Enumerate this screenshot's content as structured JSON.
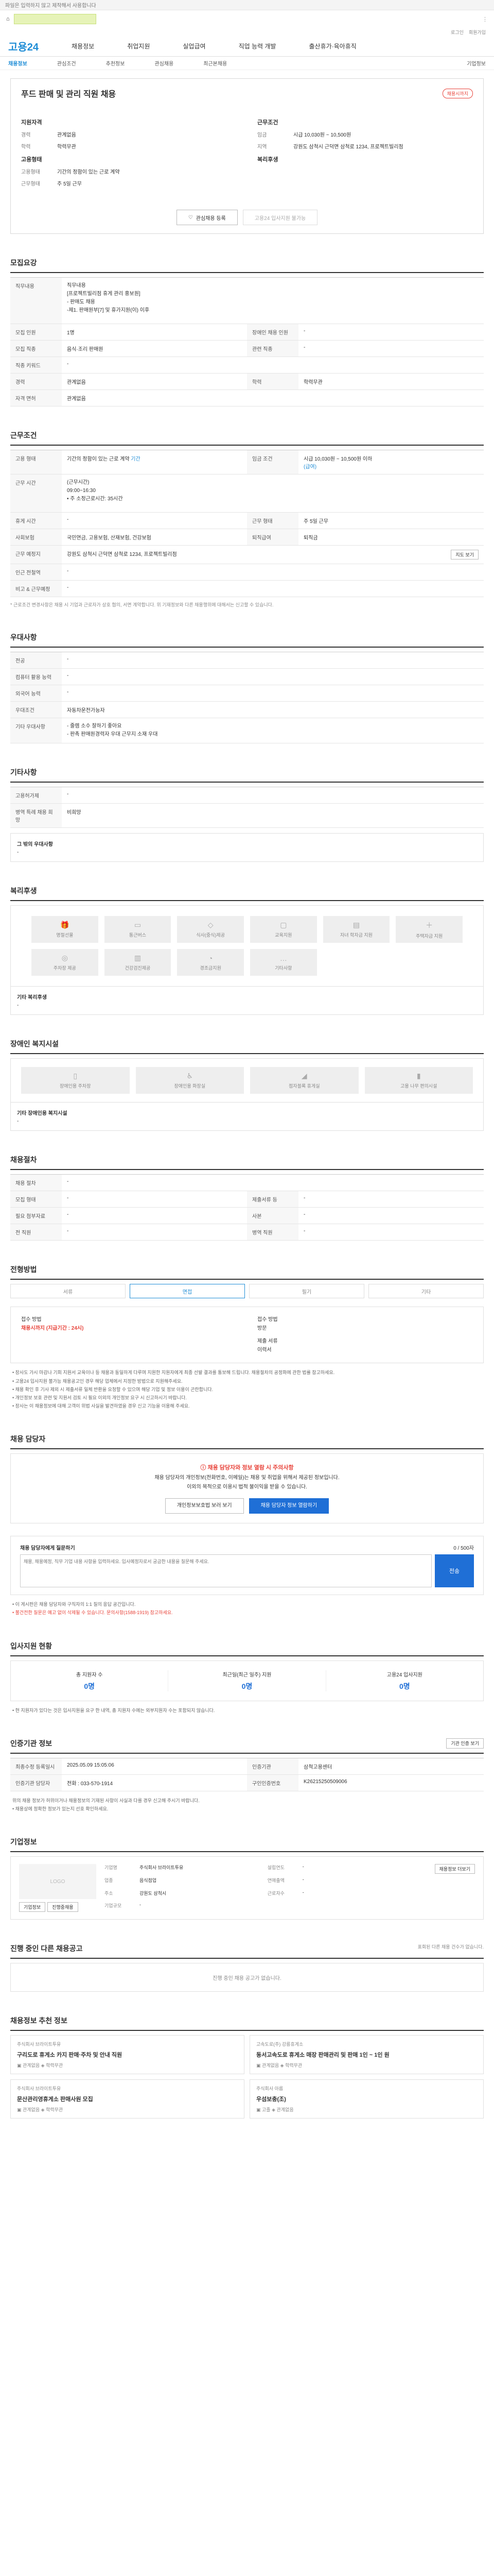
{
  "notice": "파일은 입력하지 않고 제작해서 사용합니다",
  "util": [
    "로그인",
    "회원가입"
  ],
  "logo": "고용24",
  "gnb": [
    "채용정보",
    "취업지원",
    "실업급여",
    "직업 능력 개발",
    "출산휴가·육아휴직"
  ],
  "lnb": [
    "채용정보",
    "관심조건",
    "추천정보",
    "관심채용",
    "최근본채용",
    "기업정보"
  ],
  "job": {
    "title": "푸드 판매 및 관리 직원 채용",
    "badge": "채용시까지",
    "left_head": "지원자격",
    "right_head": "근무조건",
    "left": [
      {
        "k": "경력",
        "v": "관계없음"
      },
      {
        "k": "학력",
        "v": "학력무관"
      }
    ],
    "left_head2": "고용형태",
    "left2": [
      {
        "k": "고용형태",
        "v": "기간의 정함이 있는 근로 계약"
      },
      {
        "k": "근무형태",
        "v": "주 5일 근무"
      }
    ],
    "right": [
      {
        "k": "임금",
        "v": "시급 10,030원 ~ 10,500원"
      },
      {
        "k": "지역",
        "v": "강원도 삼척시 근덕면 삼척로 1234, 프로젝트빌리점"
      }
    ],
    "right_head2": "복리후생",
    "btn_save": "관심채용 등록",
    "btn_apply": "고용24 입사지원 불가능"
  },
  "recruit": {
    "title": "모집요강",
    "duty_label": "직무내용",
    "duty": "직무내용\n[프로젝트빌리점 휴게 관리 홍보원]\n- 판매도 채용\n-제1. 판매원부[7] 및 휴가지원(이) 이후",
    "rows": [
      {
        "k": "모집 인원",
        "v": "1명",
        "k2": "장애인 채용 인원",
        "v2": "-"
      },
      {
        "k": "모집 직종",
        "v": "음식·조리 판매원",
        "k2": "관련 직종",
        "v2": "-"
      },
      {
        "k": "직종 키워드",
        "v": "-",
        "k2": "",
        "v2": ""
      },
      {
        "k": "경력",
        "v": "관계없음",
        "k2": "학력",
        "v2": "학력무관"
      },
      {
        "k": "자격 면허",
        "v": "관계없음",
        "k2": "",
        "v2": ""
      }
    ]
  },
  "condition": {
    "title": "근무조건",
    "employ_type": "기간의 정함이 있는 근로 계약",
    "employ_type_link": "기간",
    "wage_label": "임금 조건",
    "wage": "시급 10,030원 ~ 10,500원 이하",
    "wage_link": "(급여)",
    "hours_label": "근무 시간",
    "hours": "(근무시간)\n09:00~16:30\n• 주 소정근로시간: 35시간",
    "work_type_label": "근무 형태",
    "work_type": "주 5일 근무",
    "etc_rows": [
      {
        "k": "휴게 시간",
        "v": "-",
        "k2": "근무 형태",
        "v2": "주 5일 근무"
      },
      {
        "k": "사회보험",
        "v": "국민연금, 고용보험, 산재보험, 건강보험",
        "k2": "퇴직급여",
        "v2": "퇴직금"
      },
      {
        "k": "근무 예정지",
        "v": "강원도 삼척시 근덕면 삼척로 1234, 프로젝트빌리점",
        "k2": "",
        "v2": ""
      },
      {
        "k": "인근 전철역",
        "v": "-",
        "k2": "",
        "v2": ""
      },
      {
        "k": "비고 & 근무예정",
        "v": "-",
        "k2": "",
        "v2": ""
      }
    ],
    "map_btn": "지도 보기",
    "note": "* 근로조건 변경사항은 채용 시 기업과 근로자가 상호 협의, 서면 계약합니다. 위 기재정보와 다른 채용행위에 대해서는 신고할 수 있습니다."
  },
  "prefer": {
    "title": "우대사항",
    "rows": [
      {
        "k": "전공",
        "v": "-"
      },
      {
        "k": "컴퓨터 활용 능력",
        "v": "-"
      },
      {
        "k": "외국어 능력",
        "v": "-"
      },
      {
        "k": "우대조건",
        "v": "자동차운전가능자"
      },
      {
        "k": "기타 우대사항",
        "v": "- 줄렘 소수 잘하기 좋아요\n- 판촉 판매원경력자 우대 근무지 소재 우대"
      }
    ]
  },
  "other": {
    "title": "기타사항",
    "rows": [
      {
        "k": "고용허가제",
        "v": "-"
      },
      {
        "k": "병역 특례 채용 희망",
        "v": "비희망"
      }
    ],
    "etc_label": "그 밖의 우대사항",
    "etc": "-"
  },
  "welfare": {
    "title": "복리후생",
    "items": [
      {
        "icon": "gift-icon",
        "glyph": "🎁",
        "label": "명절선물"
      },
      {
        "icon": "bus-icon",
        "glyph": "▭",
        "label": "통근버스"
      },
      {
        "icon": "meal-icon",
        "glyph": "◇",
        "label": "식사(중식)제공"
      },
      {
        "icon": "gift-box-icon",
        "glyph": "▢",
        "label": "교육지원"
      },
      {
        "icon": "doc-icon",
        "glyph": "▤",
        "label": "자녀 학자금 지원"
      },
      {
        "icon": "plus-icon",
        "glyph": "＋",
        "label": "주택자금 지원"
      },
      {
        "icon": "car-icon",
        "glyph": "◎",
        "label": "주차장 제공"
      },
      {
        "icon": "leave-icon",
        "glyph": "▥",
        "label": "건강검진제공"
      },
      {
        "icon": "clock-icon",
        "glyph": "◔",
        "label": "경조금지원"
      },
      {
        "icon": "dots-icon",
        "glyph": "…",
        "label": "기타사항"
      }
    ],
    "etc_label": "기타 복리후생",
    "etc": "-"
  },
  "disabled": {
    "title": "장애인 복지시설",
    "items": [
      {
        "icon": "elevator-icon",
        "glyph": "▯",
        "label": "장애인용 주차장"
      },
      {
        "icon": "toilet-icon",
        "glyph": "♿",
        "label": "장애인용 화장실"
      },
      {
        "icon": "ramp-icon",
        "glyph": "◢",
        "label": "점자블록 휴게실"
      },
      {
        "icon": "door-icon",
        "glyph": "▮",
        "label": "고용 나무 편의시설"
      }
    ],
    "etc_label": "기타 장애인용 복지시설",
    "etc": "-"
  },
  "transfer": {
    "title": "채용절차",
    "rows": [
      {
        "k": "채용 절차",
        "v": "-",
        "k2": "",
        "v2": ""
      },
      {
        "k": "모집 형태",
        "v": "-",
        "k2": "제출서류 등",
        "v2": "-"
      },
      {
        "k": "필요 첨부자료",
        "v": "-",
        "k2": "사본",
        "v2": "-"
      },
      {
        "k": "전 직원",
        "v": "-",
        "k2": "병역 직원",
        "v2": "-"
      }
    ]
  },
  "progress": {
    "title": "전형방법",
    "steps": [
      "서류",
      "면접",
      "필기",
      "기타"
    ],
    "method_head": "접수 방법",
    "method_val": "채용시까지 (지급기간 : 24시)",
    "method_head2": "접수 방법",
    "method_val2": "방문",
    "method_head3": "제출 서류",
    "method_val3": "이력서",
    "bullets": [
      "• 장사도 가시 마감나 기회 지원서 교육이나 등 채용과 동일하게 다루며 지원한 지원자에게 최종 선발 결과를 통보해 드립니다. 채용절차의 공정화에 관한 법률 참고하세요.",
      "• 고용24 입사지원 불가능 채용공고인 경우 해당 업체에서 지정한 방법으로 지원해주세요.",
      "• 채용 확인 후 기사 제외 시 제출서류 일체 반환을 요청할 수 있으며 해당 기업 및 정보 이용이 곤란합니다.",
      "• 개인정보 보호 관련 및 지원서 검토 시 필요 이외의 개인정보 요구 시 신고하시기 바랍니다.",
      "• 장사는 이 채용정보에 대해 고객이 위법 사실을 발견하였을 경우 신고 기능을 이용해 주세요."
    ]
  },
  "manager": {
    "title": "채용 담당자",
    "alert_title": "채용 담당자와 정보 열람 시 주의사항",
    "alert_body": "채용 담당자의 개인정보(전화번호, 이메일)는 채용 및 취업을 위해서 제공된 정보입니다.\n이외의 목적으로 이용시 법적 불이익을 받을 수 있습니다.",
    "btn_view": "개인정보보호법 보러 보기",
    "btn_open": "채용 담당자 정보 열람하기"
  },
  "qa": {
    "title": "채용 담당자에게 질문하기",
    "counter": "0 / 500자",
    "placeholder": "채용, 채용예정, 직무 기업 내용 사항을 입력하세요. 입사예정자로서 궁금한 내용을 질문해 주세요.",
    "submit": "전송",
    "notes": [
      "• 이 게시판은 채용 담당자와 구직자의 1:1 질의 응답 공간입니다.",
      "• 불건전한 질문은 예고 없이 삭제될 수 있습니다. 문의사항(1588-1919) 참고하세요."
    ]
  },
  "stats": {
    "title": "입사지원 현황",
    "items": [
      {
        "label": "총 지원자 수",
        "value": "0명"
      },
      {
        "label": "최근일(최근 일주) 지원",
        "value": "0명"
      },
      {
        "label": "고용24 입사지원",
        "value": "0명"
      }
    ],
    "note": "• 현 지원자가 있다는 것은 입사지원을 요구 한 내역, 총 지원자 수에는 외부지원자 수는 포함되지 않습니다."
  },
  "cert": {
    "title": "인증기관 정보",
    "btn": "기관 인증 보기",
    "rows": [
      {
        "k": "최종수정 등록일시",
        "v": "2025.05.09 15:05:06",
        "k2": "인증기관",
        "v2": "삼척고용센터"
      },
      {
        "k": "인증기관 담당자",
        "v": "전화 : 033-570-1914",
        "k2": "구인인증번호",
        "v2": "K26215250509006"
      }
    ],
    "notes": [
      "위의 채용 정보가 허위이거나 채용정보의 기재된 사항이 사실과 다를 경우 신고해 주시기 바랍니다.",
      "• 채용상에 정확한 정보가 있는지 선호 확인하세요."
    ]
  },
  "company": {
    "title": "기업정보",
    "logo": "LOGO",
    "btn_info": "기업정보",
    "btn_jobs": "진행중채용",
    "rows": [
      {
        "k": "기업명",
        "v": "주식회사 브라이트투유",
        "k2": "설립연도",
        "v2": "-"
      },
      {
        "k": "업종",
        "v": "음식점업",
        "k2": "연매출액",
        "v2": "-"
      },
      {
        "k": "주소",
        "v": "강원도 삼척시",
        "k2": "근로자수",
        "v2": "-"
      },
      {
        "k": "기업규모",
        "v": "-",
        "k2": "",
        "v2": ""
      }
    ],
    "map_btn": "채용정보 더보기"
  },
  "ongoing": {
    "title": "진행 중인 다른 채용공고",
    "right": "표회된 다른 채용 건수가 없습니다.",
    "empty": "진행 중인 채용 공고가 없습니다."
  },
  "recommend": {
    "title": "채용정보 추천 정보",
    "items": [
      {
        "co": "주식회사 브라이트투유",
        "title": "구리도로 휴게소 카지 판매·주차 및 안내 직원",
        "loc": "관계없음",
        "wage": "학력무관"
      },
      {
        "co": "고속도로(주) 강릉휴게소",
        "title": "동서고속도로 휴게소 매장 판매관리 및 판매 1인 ~ 1인 원",
        "loc": "관계없음",
        "wage": "학력무관"
      },
      {
        "co": "주식회사 브라이트투유",
        "title": "문산관리영휴게소 판매사원 모집",
        "loc": "관계없음",
        "wage": "학력무관"
      },
      {
        "co": "주식회사 아름",
        "title": "우섬보충(조)",
        "loc": "고졸",
        "wage": "관계없음"
      }
    ]
  }
}
